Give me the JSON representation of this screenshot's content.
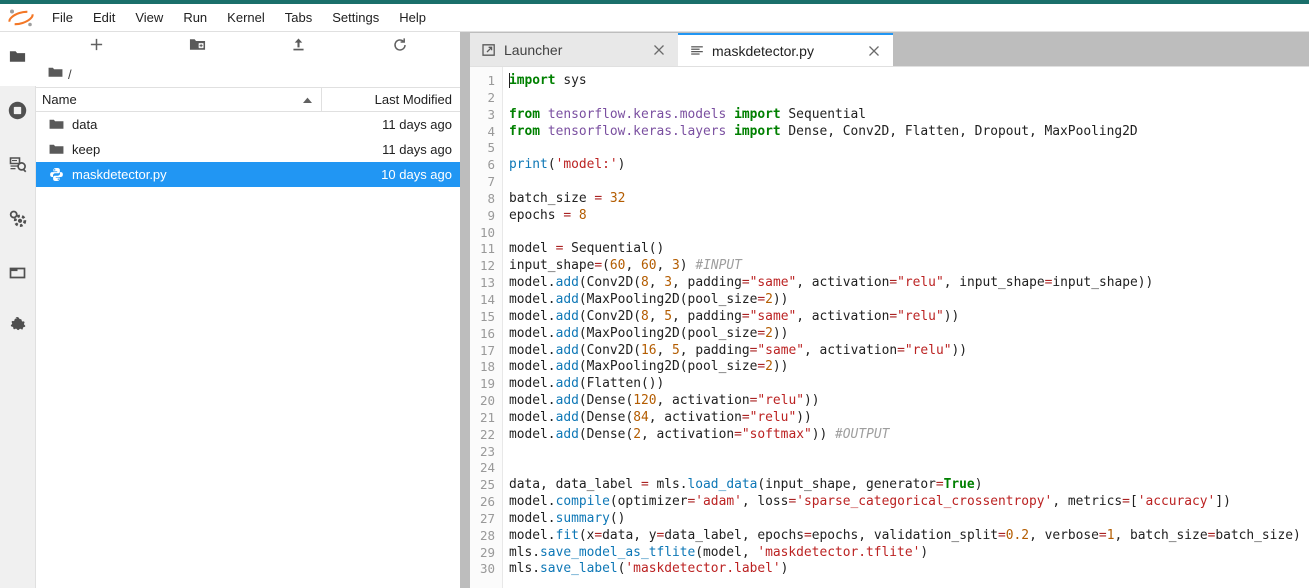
{
  "theme": {
    "accent_teal": "#1a6f6b",
    "selection_blue": "#2196f3",
    "tabbar_gray": "#bdbdbd",
    "logo_orange": "#f37726"
  },
  "menu_bar": {
    "logo_name": "jupyter-logo",
    "items": [
      {
        "label": "File"
      },
      {
        "label": "Edit"
      },
      {
        "label": "View"
      },
      {
        "label": "Run"
      },
      {
        "label": "Kernel"
      },
      {
        "label": "Tabs"
      },
      {
        "label": "Settings"
      },
      {
        "label": "Help"
      }
    ]
  },
  "activity_bar": {
    "items": [
      {
        "name": "file-browser-icon",
        "title": "File Browser",
        "active": true
      },
      {
        "name": "running-sessions-icon",
        "title": "Running Terminals and Kernels",
        "active": false
      },
      {
        "name": "table-of-contents-icon",
        "title": "Table of Contents",
        "active": false
      },
      {
        "name": "commands-gear-icon",
        "title": "Commands",
        "active": false
      },
      {
        "name": "open-tabs-icon",
        "title": "Open Tabs",
        "active": false
      },
      {
        "name": "extension-manager-icon",
        "title": "Extension Manager",
        "active": false
      }
    ]
  },
  "file_browser": {
    "toolbar": [
      {
        "name": "new-launcher-button",
        "glyph": "plus",
        "title": "New Launcher"
      },
      {
        "name": "new-folder-button",
        "glyph": "folder-plus",
        "title": "New Folder"
      },
      {
        "name": "upload-button",
        "glyph": "upload",
        "title": "Upload Files"
      },
      {
        "name": "refresh-button",
        "glyph": "refresh",
        "title": "Refresh File List"
      }
    ],
    "breadcrumb": {
      "home_icon": "folder-icon",
      "path": "/"
    },
    "columns": {
      "name": "Name",
      "last_modified": "Last Modified",
      "sort_direction": "ascending"
    },
    "rows": [
      {
        "name": "data",
        "kind": "folder",
        "modified": "11 days ago",
        "selected": false
      },
      {
        "name": "keep",
        "kind": "folder",
        "modified": "11 days ago",
        "selected": false
      },
      {
        "name": "maskdetector.py",
        "kind": "python",
        "modified": "10 days ago",
        "selected": true
      }
    ]
  },
  "tab_bar": {
    "tabs": [
      {
        "label": "Launcher",
        "icon": "launcher-icon",
        "active": false,
        "close_glyph": "×"
      },
      {
        "label": "maskdetector.py",
        "icon": "text-file-icon",
        "active": true,
        "close_glyph": "×"
      }
    ]
  },
  "editor": {
    "filename": "maskdetector.py",
    "first_line_number": 1,
    "last_line_number": 30,
    "cursor": {
      "line": 1,
      "column": 1
    },
    "line_numbers": [
      1,
      2,
      3,
      4,
      5,
      6,
      7,
      8,
      9,
      10,
      11,
      12,
      13,
      14,
      15,
      16,
      17,
      18,
      19,
      20,
      21,
      22,
      23,
      24,
      25,
      26,
      27,
      28,
      29,
      30
    ],
    "lines": [
      [
        {
          "t": "import",
          "c": "kw"
        },
        {
          "t": " sys",
          "c": "pl"
        }
      ],
      [],
      [
        {
          "t": "from",
          "c": "kw"
        },
        {
          "t": " ",
          "c": "pl"
        },
        {
          "t": "tensorflow.keras.models",
          "c": "mod"
        },
        {
          "t": " ",
          "c": "pl"
        },
        {
          "t": "import",
          "c": "kw"
        },
        {
          "t": " Sequential",
          "c": "pl"
        }
      ],
      [
        {
          "t": "from",
          "c": "kw"
        },
        {
          "t": " ",
          "c": "pl"
        },
        {
          "t": "tensorflow.keras.layers",
          "c": "mod"
        },
        {
          "t": " ",
          "c": "pl"
        },
        {
          "t": "import",
          "c": "kw"
        },
        {
          "t": " Dense, Conv2D, Flatten, Dropout, MaxPooling2D",
          "c": "pl"
        }
      ],
      [],
      [
        {
          "t": "print",
          "c": "fn"
        },
        {
          "t": "(",
          "c": "pl"
        },
        {
          "t": "'model:'",
          "c": "str"
        },
        {
          "t": ")",
          "c": "pl"
        }
      ],
      [],
      [
        {
          "t": "batch_size ",
          "c": "pl"
        },
        {
          "t": "=",
          "c": "op"
        },
        {
          "t": " ",
          "c": "pl"
        },
        {
          "t": "32",
          "c": "num"
        }
      ],
      [
        {
          "t": "epochs ",
          "c": "pl"
        },
        {
          "t": "=",
          "c": "op"
        },
        {
          "t": " ",
          "c": "pl"
        },
        {
          "t": "8",
          "c": "num"
        }
      ],
      [],
      [
        {
          "t": "model ",
          "c": "pl"
        },
        {
          "t": "=",
          "c": "op"
        },
        {
          "t": " Sequential()",
          "c": "pl"
        }
      ],
      [
        {
          "t": "input_shape",
          "c": "pl"
        },
        {
          "t": "=",
          "c": "op"
        },
        {
          "t": "(",
          "c": "pl"
        },
        {
          "t": "60",
          "c": "num"
        },
        {
          "t": ", ",
          "c": "pl"
        },
        {
          "t": "60",
          "c": "num"
        },
        {
          "t": ", ",
          "c": "pl"
        },
        {
          "t": "3",
          "c": "num"
        },
        {
          "t": ") ",
          "c": "pl"
        },
        {
          "t": "#INPUT",
          "c": "cm"
        }
      ],
      [
        {
          "t": "model.",
          "c": "pl"
        },
        {
          "t": "add",
          "c": "fn"
        },
        {
          "t": "(Conv2D(",
          "c": "pl"
        },
        {
          "t": "8",
          "c": "num"
        },
        {
          "t": ", ",
          "c": "pl"
        },
        {
          "t": "3",
          "c": "num"
        },
        {
          "t": ", padding",
          "c": "pl"
        },
        {
          "t": "=",
          "c": "op"
        },
        {
          "t": "\"same\"",
          "c": "str"
        },
        {
          "t": ", activation",
          "c": "pl"
        },
        {
          "t": "=",
          "c": "op"
        },
        {
          "t": "\"relu\"",
          "c": "str"
        },
        {
          "t": ", input_shape",
          "c": "pl"
        },
        {
          "t": "=",
          "c": "op"
        },
        {
          "t": "input_shape))",
          "c": "pl"
        }
      ],
      [
        {
          "t": "model.",
          "c": "pl"
        },
        {
          "t": "add",
          "c": "fn"
        },
        {
          "t": "(MaxPooling2D(pool_size",
          "c": "pl"
        },
        {
          "t": "=",
          "c": "op"
        },
        {
          "t": "2",
          "c": "num"
        },
        {
          "t": "))",
          "c": "pl"
        }
      ],
      [
        {
          "t": "model.",
          "c": "pl"
        },
        {
          "t": "add",
          "c": "fn"
        },
        {
          "t": "(Conv2D(",
          "c": "pl"
        },
        {
          "t": "8",
          "c": "num"
        },
        {
          "t": ", ",
          "c": "pl"
        },
        {
          "t": "5",
          "c": "num"
        },
        {
          "t": ", padding",
          "c": "pl"
        },
        {
          "t": "=",
          "c": "op"
        },
        {
          "t": "\"same\"",
          "c": "str"
        },
        {
          "t": ", activation",
          "c": "pl"
        },
        {
          "t": "=",
          "c": "op"
        },
        {
          "t": "\"relu\"",
          "c": "str"
        },
        {
          "t": "))",
          "c": "pl"
        }
      ],
      [
        {
          "t": "model.",
          "c": "pl"
        },
        {
          "t": "add",
          "c": "fn"
        },
        {
          "t": "(MaxPooling2D(pool_size",
          "c": "pl"
        },
        {
          "t": "=",
          "c": "op"
        },
        {
          "t": "2",
          "c": "num"
        },
        {
          "t": "))",
          "c": "pl"
        }
      ],
      [
        {
          "t": "model.",
          "c": "pl"
        },
        {
          "t": "add",
          "c": "fn"
        },
        {
          "t": "(Conv2D(",
          "c": "pl"
        },
        {
          "t": "16",
          "c": "num"
        },
        {
          "t": ", ",
          "c": "pl"
        },
        {
          "t": "5",
          "c": "num"
        },
        {
          "t": ", padding",
          "c": "pl"
        },
        {
          "t": "=",
          "c": "op"
        },
        {
          "t": "\"same\"",
          "c": "str"
        },
        {
          "t": ", activation",
          "c": "pl"
        },
        {
          "t": "=",
          "c": "op"
        },
        {
          "t": "\"relu\"",
          "c": "str"
        },
        {
          "t": "))",
          "c": "pl"
        }
      ],
      [
        {
          "t": "model.",
          "c": "pl"
        },
        {
          "t": "add",
          "c": "fn"
        },
        {
          "t": "(MaxPooling2D(pool_size",
          "c": "pl"
        },
        {
          "t": "=",
          "c": "op"
        },
        {
          "t": "2",
          "c": "num"
        },
        {
          "t": "))",
          "c": "pl"
        }
      ],
      [
        {
          "t": "model.",
          "c": "pl"
        },
        {
          "t": "add",
          "c": "fn"
        },
        {
          "t": "(Flatten())",
          "c": "pl"
        }
      ],
      [
        {
          "t": "model.",
          "c": "pl"
        },
        {
          "t": "add",
          "c": "fn"
        },
        {
          "t": "(Dense(",
          "c": "pl"
        },
        {
          "t": "120",
          "c": "num"
        },
        {
          "t": ", activation",
          "c": "pl"
        },
        {
          "t": "=",
          "c": "op"
        },
        {
          "t": "\"relu\"",
          "c": "str"
        },
        {
          "t": "))",
          "c": "pl"
        }
      ],
      [
        {
          "t": "model.",
          "c": "pl"
        },
        {
          "t": "add",
          "c": "fn"
        },
        {
          "t": "(Dense(",
          "c": "pl"
        },
        {
          "t": "84",
          "c": "num"
        },
        {
          "t": ", activation",
          "c": "pl"
        },
        {
          "t": "=",
          "c": "op"
        },
        {
          "t": "\"relu\"",
          "c": "str"
        },
        {
          "t": "))",
          "c": "pl"
        }
      ],
      [
        {
          "t": "model.",
          "c": "pl"
        },
        {
          "t": "add",
          "c": "fn"
        },
        {
          "t": "(Dense(",
          "c": "pl"
        },
        {
          "t": "2",
          "c": "num"
        },
        {
          "t": ", activation",
          "c": "pl"
        },
        {
          "t": "=",
          "c": "op"
        },
        {
          "t": "\"softmax\"",
          "c": "str"
        },
        {
          "t": ")) ",
          "c": "pl"
        },
        {
          "t": "#OUTPUT",
          "c": "cm"
        }
      ],
      [],
      [],
      [
        {
          "t": "data, data_label ",
          "c": "pl"
        },
        {
          "t": "=",
          "c": "op"
        },
        {
          "t": " mls.",
          "c": "pl"
        },
        {
          "t": "load_data",
          "c": "fn"
        },
        {
          "t": "(input_shape, generator",
          "c": "pl"
        },
        {
          "t": "=",
          "c": "op"
        },
        {
          "t": "True",
          "c": "bi"
        },
        {
          "t": ")",
          "c": "pl"
        }
      ],
      [
        {
          "t": "model.",
          "c": "pl"
        },
        {
          "t": "compile",
          "c": "fn"
        },
        {
          "t": "(optimizer",
          "c": "pl"
        },
        {
          "t": "=",
          "c": "op"
        },
        {
          "t": "'adam'",
          "c": "str"
        },
        {
          "t": ", loss",
          "c": "pl"
        },
        {
          "t": "=",
          "c": "op"
        },
        {
          "t": "'sparse_categorical_crossentropy'",
          "c": "str"
        },
        {
          "t": ", metrics",
          "c": "pl"
        },
        {
          "t": "=",
          "c": "op"
        },
        {
          "t": "[",
          "c": "pl"
        },
        {
          "t": "'accuracy'",
          "c": "str"
        },
        {
          "t": "])",
          "c": "pl"
        }
      ],
      [
        {
          "t": "model.",
          "c": "pl"
        },
        {
          "t": "summary",
          "c": "fn"
        },
        {
          "t": "()",
          "c": "pl"
        }
      ],
      [
        {
          "t": "model.",
          "c": "pl"
        },
        {
          "t": "fit",
          "c": "fn"
        },
        {
          "t": "(x",
          "c": "pl"
        },
        {
          "t": "=",
          "c": "op"
        },
        {
          "t": "data, y",
          "c": "pl"
        },
        {
          "t": "=",
          "c": "op"
        },
        {
          "t": "data_label, epochs",
          "c": "pl"
        },
        {
          "t": "=",
          "c": "op"
        },
        {
          "t": "epochs, validation_split",
          "c": "pl"
        },
        {
          "t": "=",
          "c": "op"
        },
        {
          "t": "0.2",
          "c": "num"
        },
        {
          "t": ", verbose",
          "c": "pl"
        },
        {
          "t": "=",
          "c": "op"
        },
        {
          "t": "1",
          "c": "num"
        },
        {
          "t": ", batch_size",
          "c": "pl"
        },
        {
          "t": "=",
          "c": "op"
        },
        {
          "t": "batch_size)",
          "c": "pl"
        }
      ],
      [
        {
          "t": "mls.",
          "c": "pl"
        },
        {
          "t": "save_model_as_tflite",
          "c": "fn"
        },
        {
          "t": "(model, ",
          "c": "pl"
        },
        {
          "t": "'maskdetector.tflite'",
          "c": "str"
        },
        {
          "t": ")",
          "c": "pl"
        }
      ],
      [
        {
          "t": "mls.",
          "c": "pl"
        },
        {
          "t": "save_label",
          "c": "fn"
        },
        {
          "t": "(",
          "c": "pl"
        },
        {
          "t": "'maskdetector.label'",
          "c": "str"
        },
        {
          "t": ")",
          "c": "pl"
        }
      ]
    ]
  }
}
